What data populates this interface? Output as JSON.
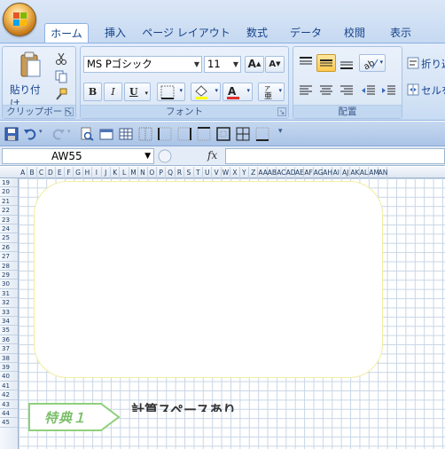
{
  "ribbon": {
    "tabs": [
      {
        "label": "ホーム",
        "active": true
      },
      {
        "label": "挿入"
      },
      {
        "label": "ページ レイアウト"
      },
      {
        "label": "数式"
      },
      {
        "label": "データ"
      },
      {
        "label": "校閲"
      },
      {
        "label": "表示"
      }
    ],
    "clipboard": {
      "paste_label": "貼り付け",
      "group_label": "クリップボード"
    },
    "font": {
      "font_name": "MS Pゴシック",
      "font_size": "11",
      "bold": "B",
      "italic": "I",
      "underline": "U",
      "group_label": "フォント"
    },
    "alignment": {
      "wrap_label": "折り返",
      "merge_label": "セルを",
      "group_label": "配置"
    }
  },
  "formula_bar": {
    "name_box": "AW55",
    "fx_label": "fx",
    "formula": ""
  },
  "sheet": {
    "columns": [
      "A",
      "B",
      "C",
      "D",
      "E",
      "F",
      "G",
      "H",
      "I",
      "J",
      "K",
      "L",
      "M",
      "N",
      "O",
      "P",
      "Q",
      "R",
      "S",
      "T",
      "U",
      "V",
      "W",
      "X",
      "Y",
      "Z",
      "AA",
      "AB",
      "AC",
      "AD",
      "AE",
      "AF",
      "AG",
      "AH",
      "AI",
      "AJ",
      "AK",
      "AL",
      "AM",
      "AN"
    ],
    "rows": [
      "19",
      "20",
      "21",
      "22",
      "23",
      "24",
      "25",
      "26",
      "27",
      "28",
      "29",
      "30",
      "31",
      "32",
      "33",
      "34",
      "35",
      "36",
      "37",
      "38",
      "39",
      "40",
      "41",
      "42",
      "43",
      "44",
      "45"
    ],
    "banner_label": "特典１",
    "caption": "計算スペースあり"
  },
  "colors": {
    "accent": "#15428b",
    "ribbon_bg": "#dbe7f7",
    "grid_line": "#c9d6e6",
    "banner_green": "#7bbf6a",
    "box_border": "#f0eea0"
  }
}
